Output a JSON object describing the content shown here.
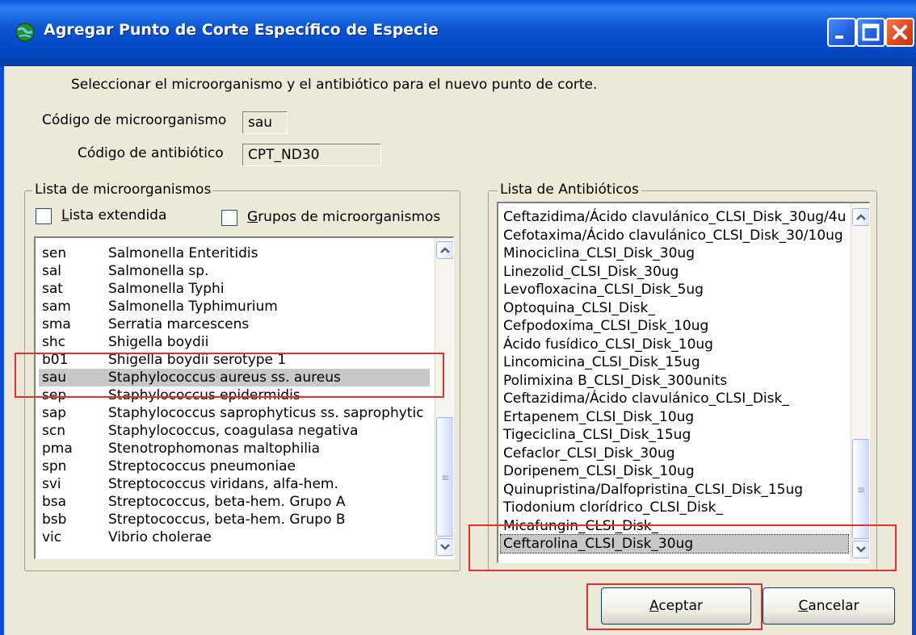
{
  "window": {
    "title": "Agregar Punto de Corte Específico de Especie"
  },
  "instruction": "Seleccionar el microorganismo y el antibiótico para el nuevo punto de corte.",
  "fields": {
    "micro_code_label": "Código de microorganismo",
    "micro_code_value": "sau",
    "antibiotic_code_label": "Código de antibiótico",
    "antibiotic_code_value": "CPT_ND30"
  },
  "microorganisms": {
    "group_title": "Lista de microorganismos",
    "extended_list_label": "Lista extendida",
    "groups_label": "Grupos de microorganismos",
    "items": [
      {
        "code": "sen",
        "name": "Salmonella Enteritidis"
      },
      {
        "code": "sal",
        "name": "Salmonella sp."
      },
      {
        "code": "sat",
        "name": "Salmonella Typhi"
      },
      {
        "code": "sam",
        "name": "Salmonella Typhimurium"
      },
      {
        "code": "sma",
        "name": "Serratia marcescens"
      },
      {
        "code": "shc",
        "name": "Shigella boydii"
      },
      {
        "code": "b01",
        "name": "Shigella boydii serotype 1"
      },
      {
        "code": "sau",
        "name": "Staphylococcus aureus ss. aureus"
      },
      {
        "code": "sep",
        "name": "Staphylococcus epidermidis"
      },
      {
        "code": "sap",
        "name": "Staphylococcus saprophyticus ss. saprophytic"
      },
      {
        "code": "scn",
        "name": "Staphylococcus, coagulasa negativa"
      },
      {
        "code": "pma",
        "name": "Stenotrophomonas maltophilia"
      },
      {
        "code": "spn",
        "name": "Streptococcus pneumoniae"
      },
      {
        "code": "svi",
        "name": "Streptococcus viridans, alfa-hem."
      },
      {
        "code": "bsa",
        "name": "Streptococcus, beta-hem. Grupo A"
      },
      {
        "code": "bsb",
        "name": "Streptococcus, beta-hem. Grupo B"
      },
      {
        "code": "vic",
        "name": "Vibrio cholerae"
      }
    ],
    "selected_index": 7
  },
  "antibiotics": {
    "group_title": "Lista de Antibióticos",
    "items": [
      "Ceftazidima/Ácido clavulánico_CLSI_Disk_30ug/4u",
      "Cefotaxima/Ácido clavulánico_CLSI_Disk_30/10ug",
      "Minociclina_CLSI_Disk_30ug",
      "Linezolid_CLSI_Disk_30ug",
      "Levofloxacina_CLSI_Disk_5ug",
      "Optoquina_CLSI_Disk_",
      "Cefpodoxima_CLSI_Disk_10ug",
      "Ácido fusídico_CLSI_Disk_10ug",
      "Lincomicina_CLSI_Disk_15ug",
      "Polimixina B_CLSI_Disk_300units",
      "Ceftazidima/Ácido clavulánico_CLSI_Disk_",
      "Ertapenem_CLSI_Disk_10ug",
      "Tigeciclina_CLSI_Disk_15ug",
      "Cefaclor_CLSI_Disk_30ug",
      "Doripenem_CLSI_Disk_10ug",
      "Quinupristina/Dalfopristina_CLSI_Disk_15ug",
      "Tiodonium clorídrico_CLSI_Disk_",
      "Micafungin_CLSI_Disk_",
      "Ceftarolina_CLSI_Disk_30ug"
    ],
    "selected_index": 18
  },
  "buttons": {
    "accept_rest": "ceptar",
    "accept_key": "A",
    "cancel_rest": "ancelar",
    "cancel_key": "C"
  },
  "colors": {
    "titlebar": "#0a53d0",
    "highlight_box": "#e03030",
    "selection": "#c8c8c8"
  }
}
